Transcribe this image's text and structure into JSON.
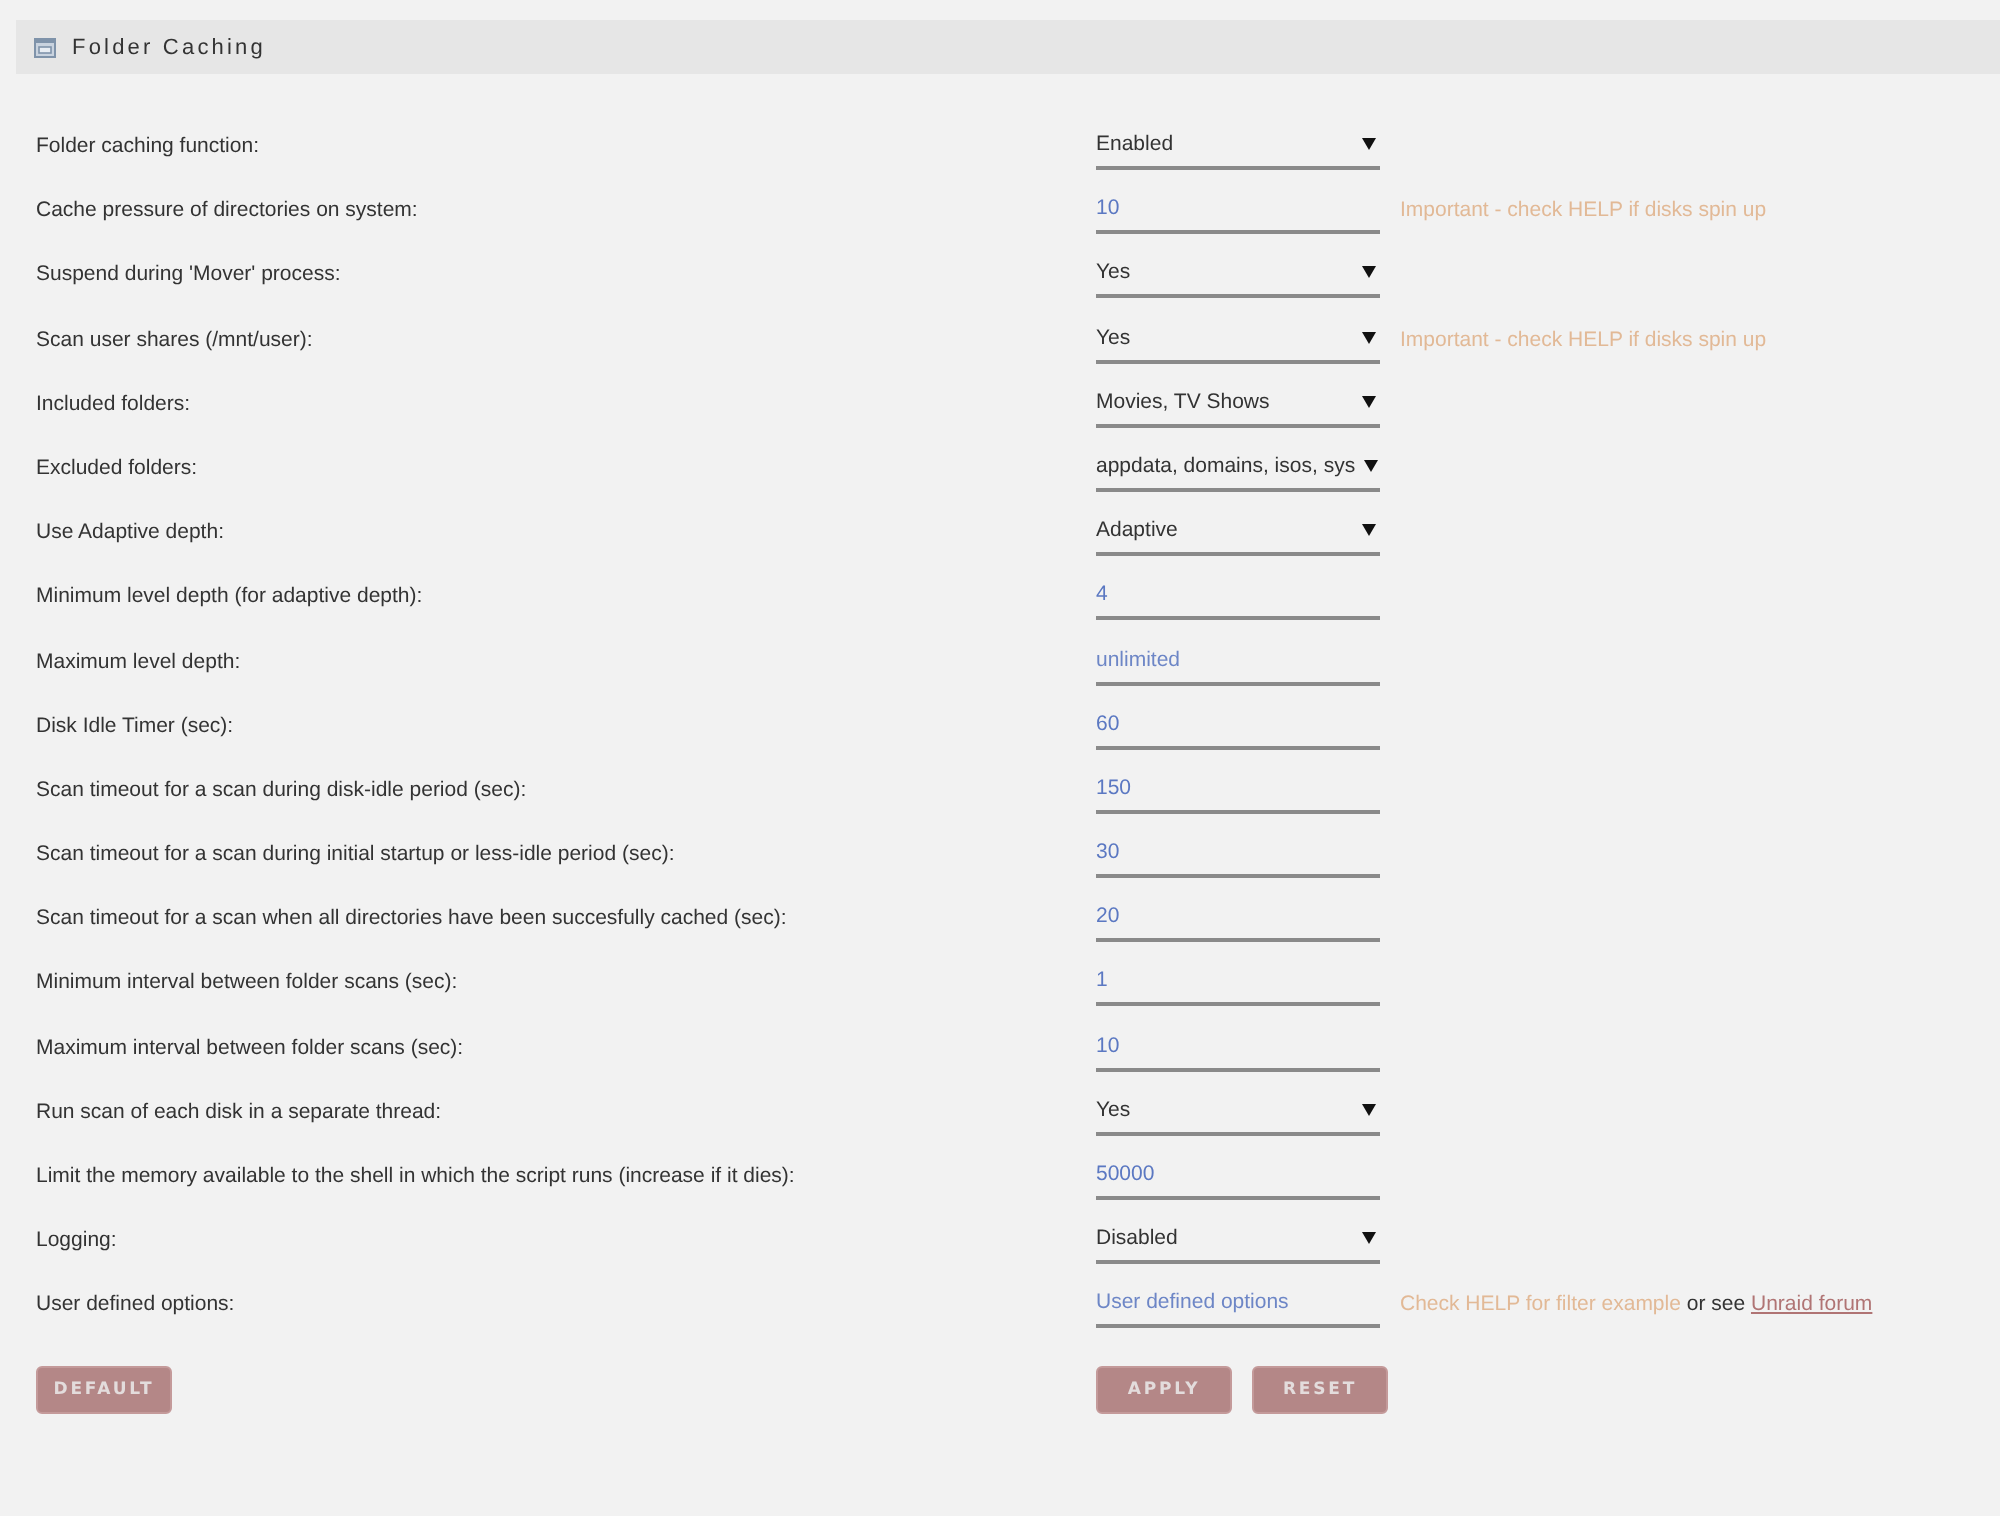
{
  "header": {
    "title": "Folder Caching"
  },
  "settings": [
    {
      "label": "Folder caching function:",
      "kind": "select",
      "value": "Enabled"
    },
    {
      "label": "Cache pressure of directories on system:",
      "kind": "input",
      "value": "10",
      "hint": [
        {
          "kind": "note",
          "text": "Important - check HELP if disks spin up"
        }
      ]
    },
    {
      "label": "Suspend during 'Mover' process:",
      "kind": "select",
      "value": "Yes"
    },
    {
      "label": "Scan user shares (/mnt/user):",
      "kind": "select",
      "value": "Yes",
      "hint": [
        {
          "kind": "note",
          "text": "Important - check HELP if disks spin up"
        }
      ]
    },
    {
      "label": "Included folders:",
      "kind": "select",
      "value": "Movies, TV Shows"
    },
    {
      "label": "Excluded folders:",
      "kind": "select",
      "value": "appdata, domains, isos, sys"
    },
    {
      "label": "Use Adaptive depth:",
      "kind": "select",
      "value": "Adaptive"
    },
    {
      "label": "Minimum level depth (for adaptive depth):",
      "kind": "input",
      "value": "4"
    },
    {
      "label": "Maximum level depth:",
      "kind": "input",
      "placeholder": "unlimited"
    },
    {
      "label": "Disk Idle Timer (sec):",
      "kind": "input",
      "value": "60"
    },
    {
      "label": "Scan timeout for a scan during disk-idle period (sec):",
      "kind": "input",
      "value": "150"
    },
    {
      "label": "Scan timeout for a scan during initial startup or less-idle period (sec):",
      "kind": "input",
      "value": "30"
    },
    {
      "label": "Scan timeout for a scan when all directories have been succesfully cached (sec):",
      "kind": "input",
      "value": "20"
    },
    {
      "label": "Minimum interval between folder scans (sec):",
      "kind": "input",
      "value": "1"
    },
    {
      "label": "Maximum interval between folder scans (sec):",
      "kind": "input",
      "value": "10"
    },
    {
      "label": "Run scan of each disk in a separate thread:",
      "kind": "select",
      "value": "Yes"
    },
    {
      "label": "Limit the memory available to the shell in which the script runs (increase if it dies):",
      "kind": "input",
      "value": "50000"
    },
    {
      "label": "Logging:",
      "kind": "select",
      "value": "Disabled"
    },
    {
      "label": "User defined options:",
      "kind": "input",
      "placeholder": "User defined options",
      "hint": [
        {
          "kind": "note",
          "text": "Check HELP for filter example"
        },
        {
          "kind": "text",
          "text": "or see"
        },
        {
          "kind": "link",
          "text": "Unraid forum"
        }
      ]
    }
  ],
  "buttons": {
    "left": [
      "DEFAULT"
    ],
    "right": [
      "APPLY",
      "RESET"
    ]
  }
}
